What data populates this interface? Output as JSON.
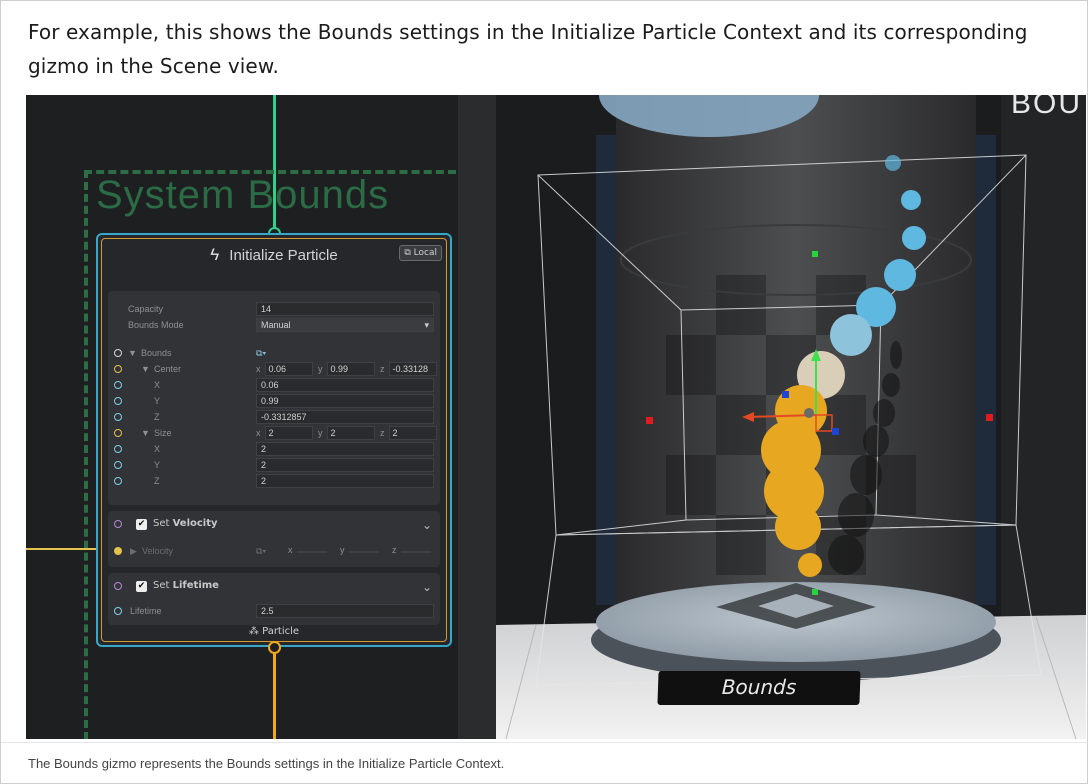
{
  "intro_text": "For example, this shows the Bounds settings in the Initialize Particle Context and its corresponding gizmo in the Scene view.",
  "caption_text": "The Bounds gizmo represents the Bounds settings in the Initialize Particle Context.",
  "graph": {
    "system_label": "System Bounds",
    "node": {
      "title": "Initialize Particle",
      "space_button": "Local",
      "capacity": {
        "label": "Capacity",
        "value": "14"
      },
      "bounds_mode": {
        "label": "Bounds Mode",
        "value": "Manual"
      },
      "bounds": {
        "label": "Bounds",
        "center": {
          "label": "Center",
          "x": "0.06",
          "y": "0.99",
          "z": "-0.33128"
        },
        "center_x": {
          "label": "X",
          "value": "0.06"
        },
        "center_y": {
          "label": "Y",
          "value": "0.99"
        },
        "center_z": {
          "label": "Z",
          "value": "-0.3312857"
        },
        "size": {
          "label": "Size",
          "x": "2",
          "y": "2",
          "z": "2"
        },
        "size_x": {
          "label": "X",
          "value": "2"
        },
        "size_y": {
          "label": "Y",
          "value": "2"
        },
        "size_z": {
          "label": "Z",
          "value": "2"
        }
      },
      "set_velocity": {
        "prefix": "Set",
        "name": "Velocity",
        "attr_label": "Velocity",
        "x_key": "x",
        "y_key": "y",
        "z_key": "z"
      },
      "set_lifetime": {
        "prefix": "Set",
        "name": "Lifetime",
        "attr_label": "Lifetime",
        "value": "2.5"
      },
      "output_label": "Particle"
    },
    "axis_keys": {
      "x": "x",
      "y": "y",
      "z": "z"
    }
  },
  "scene": {
    "partial_sign_text": "BOU",
    "plate_text": "Bounds"
  },
  "colors": {
    "node_border": "#36a6c9",
    "node_inner_border": "#d69b2c",
    "system_bounds": "#2d6d46",
    "flow_green": "#2fd18a",
    "flow_orange": "#f2a81d",
    "particle_orange": "#e7a721",
    "particle_blue": "#5fb8df"
  },
  "icons": {
    "title": "lightning-bolt-icon",
    "space": "local-space-cube-icon",
    "output": "particle-sparkle-icon",
    "expand": "chevron-down-icon",
    "checkbox": "checkmark-icon"
  }
}
